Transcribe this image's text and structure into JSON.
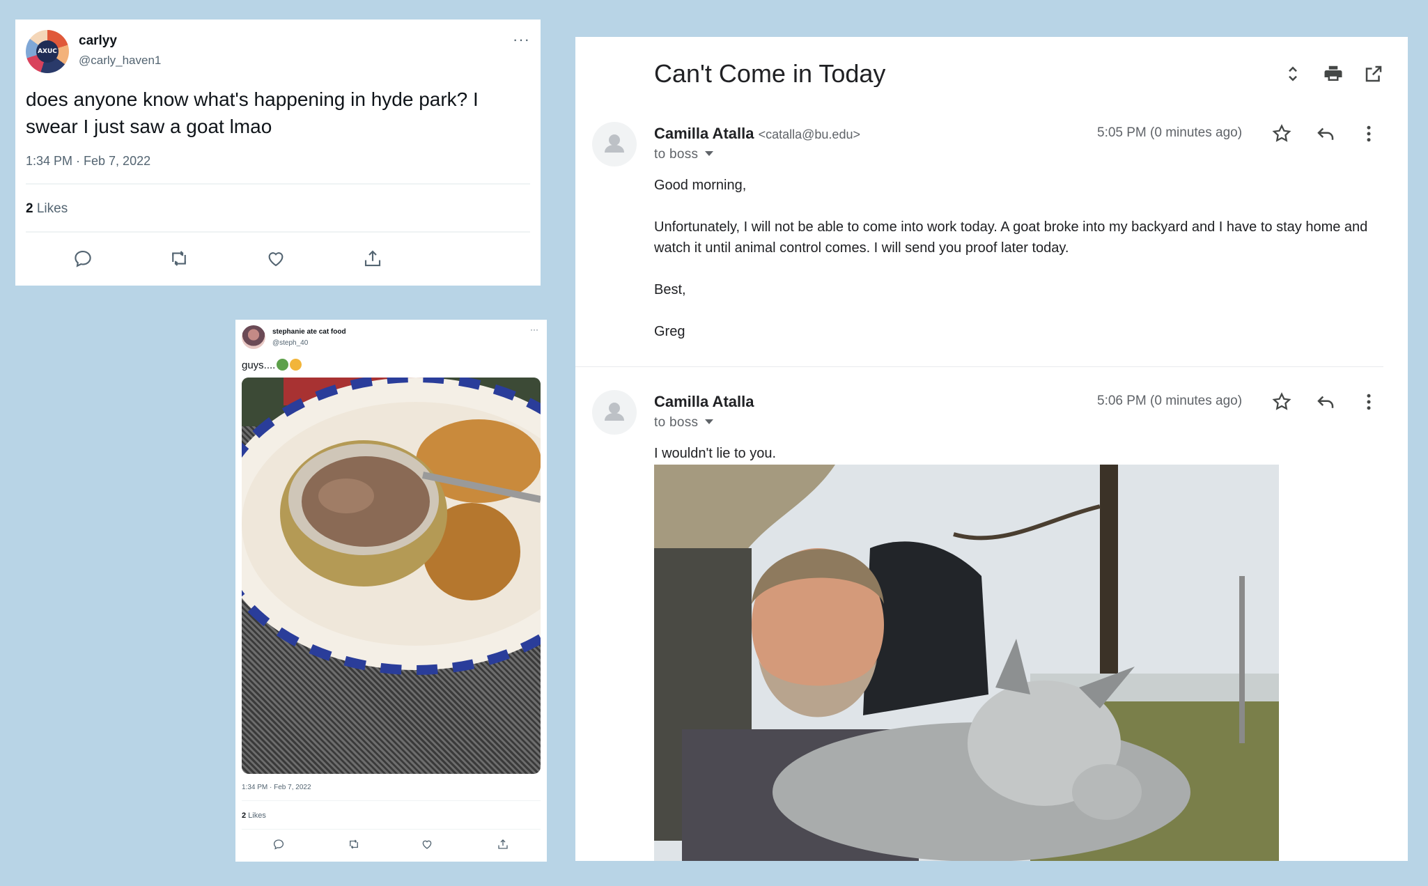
{
  "tweet1": {
    "avatar_text": "AXUC",
    "name": "carlyy",
    "handle": "@carly_haven1",
    "more": "···",
    "text": "does anyone know what's happening in hyde park? I swear I just saw a goat lmao",
    "time": "1:34 PM · Feb 7, 2022",
    "likes_count": "2",
    "likes_label": " Likes",
    "actions": [
      "reply-icon",
      "retweet-icon",
      "like-icon",
      "share-icon"
    ]
  },
  "tweet2": {
    "name": "stephanie ate cat food",
    "handle": "@steph_40",
    "more": "···",
    "text": "guys....",
    "emojis": [
      "nauseated-face-emoji",
      "cat-face-emoji"
    ],
    "time": "1:34 PM · Feb 7, 2022",
    "likes_count": "2",
    "likes_label": " Likes",
    "colors": {
      "plate_blue": "#2a3d9a",
      "food": "#8a6a55"
    }
  },
  "email": {
    "subject": "Can't Come in Today",
    "messages": [
      {
        "from_name": "Camilla Atalla",
        "from_email": "<catalla@bu.edu>",
        "to": "to boss",
        "time": "5:05 PM (0 minutes ago)",
        "body": [
          "Good morning,",
          "Unfortunately, I will not be able to come into work today. A goat broke into my backyard and I have to stay home and watch it until animal control comes. I will send you proof later today.",
          "Best,",
          "Greg"
        ]
      },
      {
        "from_name": "Camilla Atalla",
        "to": "to boss",
        "time": "5:06 PM (0 minutes ago)",
        "body": [
          "I wouldn't lie to you."
        ]
      }
    ],
    "colors": {
      "text": "#202124",
      "muted": "#5f6368",
      "icon": "#444746"
    }
  }
}
